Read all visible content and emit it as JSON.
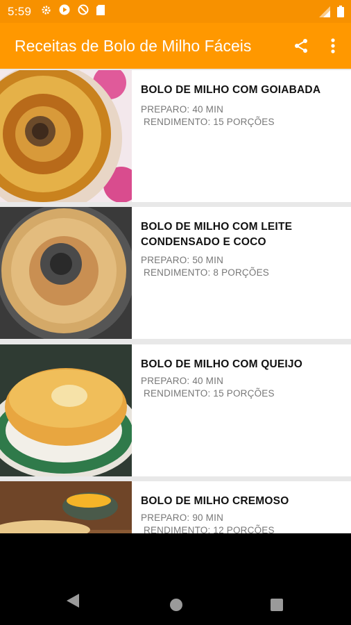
{
  "status_bar": {
    "time": "5:59",
    "icons": [
      "settings-icon",
      "play-icon",
      "sync-blocked-icon",
      "sd-card-icon"
    ],
    "right_icons": [
      "signal-icon",
      "battery-icon"
    ]
  },
  "app_bar": {
    "title": "Receitas de Bolo de Milho Fáceis",
    "actions": [
      "share-icon",
      "more-vert-icon"
    ],
    "color": "#FF9800"
  },
  "recipes": [
    {
      "title": "BOLO DE MILHO COM GOIABADA",
      "prep": "PREPARO: 40 MIN",
      "yield": "RENDIMENTO: 15 PORÇÕES",
      "image": "cake-goiabada-photo"
    },
    {
      "title": "BOLO DE MILHO COM LEITE CONDENSADO E COCO",
      "prep": "PREPARO: 50 MIN",
      "yield": "RENDIMENTO: 8 PORÇÕES",
      "image": "cake-leite-condensado-photo"
    },
    {
      "title": "BOLO DE MILHO COM QUEIJO",
      "prep": "PREPARO: 40 MIN",
      "yield": "RENDIMENTO: 15 PORÇÕES",
      "image": "cake-queijo-photo"
    },
    {
      "title": "BOLO DE MILHO CREMOSO",
      "prep": "PREPARO: 90 MIN",
      "yield": "RENDIMENTO: 12 PORÇÕES",
      "image": "cake-cremoso-photo"
    }
  ],
  "nav_bar": {
    "buttons": [
      "back-icon",
      "home-icon",
      "recents-icon"
    ]
  }
}
